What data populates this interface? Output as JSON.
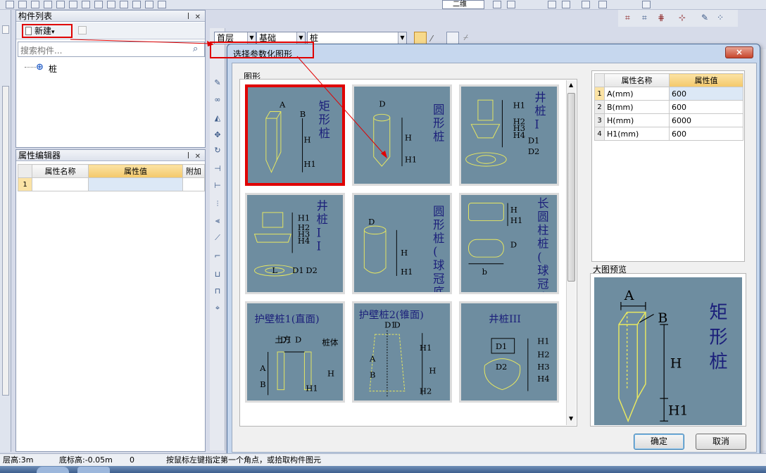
{
  "component_list": {
    "title": "构件列表",
    "new_button": "新建",
    "new_arrow": "▾",
    "search_placeholder": "搜索构件...",
    "tree_item": "桩"
  },
  "property_editor": {
    "title": "属性编辑器",
    "col_name": "属性名称",
    "col_value": "属性值",
    "col_extra": "附加",
    "row_num": "1"
  },
  "toolbar": {
    "floor": "首层",
    "category": "基础",
    "type": "桩",
    "right_tab": "二维"
  },
  "dialog": {
    "title": "选择参数化图形",
    "close": "×",
    "group_label": "图形",
    "preview_label": "大图预览",
    "ok": "确定",
    "cancel": "取消",
    "props_header_name": "属性名称",
    "props_header_value": "属性值",
    "props": [
      {
        "n": "1",
        "name": "A(mm)",
        "value": "600"
      },
      {
        "n": "2",
        "name": "B(mm)",
        "value": "600"
      },
      {
        "n": "3",
        "name": "H(mm)",
        "value": "6000"
      },
      {
        "n": "4",
        "name": "H1(mm)",
        "value": "600"
      }
    ],
    "tiles": [
      {
        "title": "矩形桩",
        "labels": [
          "A",
          "B",
          "H",
          "H1"
        ]
      },
      {
        "title": "圆形桩",
        "labels": [
          "D",
          "H",
          "H1"
        ]
      },
      {
        "title": "井桩I",
        "labels": [
          "H1",
          "H2",
          "H3",
          "H4",
          "D1",
          "D2"
        ]
      },
      {
        "title": "井桩II",
        "labels": [
          "H1",
          "H2",
          "H3",
          "H4",
          "L",
          "D1",
          "D2"
        ]
      },
      {
        "title": "圆形桩(球冠底)",
        "labels": [
          "D",
          "H",
          "H1"
        ]
      },
      {
        "title": "长圆柱桩(球冠底)",
        "labels": [
          "H",
          "H1",
          "D",
          "b"
        ]
      },
      {
        "title": "护壁桩1(直面)",
        "labels": [
          "土方",
          "D1",
          "D",
          "桩体",
          "A",
          "B",
          "H",
          "H1"
        ]
      },
      {
        "title": "护壁桩2(锥面)",
        "labels": [
          "D1",
          "D",
          "H1",
          "A",
          "B",
          "H",
          "H2"
        ]
      },
      {
        "title": "井桩III",
        "labels": [
          "D1",
          "D2",
          "H1",
          "H2",
          "H3",
          "H4"
        ]
      }
    ],
    "preview": {
      "title": "矩形桩",
      "labels": [
        "A",
        "B",
        "H",
        "H1"
      ]
    }
  },
  "status": {
    "floor_height": "层高:3m",
    "base_elev": "底标高:-0.05m",
    "zero": "0",
    "hint": "按鼠标左键指定第一个角点，或拾取构件图元"
  },
  "colors": {
    "tile_bg": "#6e8da0",
    "tile_text": "#1b1f7a",
    "shape_line": "#e8e860",
    "highlight": "#e00000",
    "header_value": "#f4c86a"
  }
}
